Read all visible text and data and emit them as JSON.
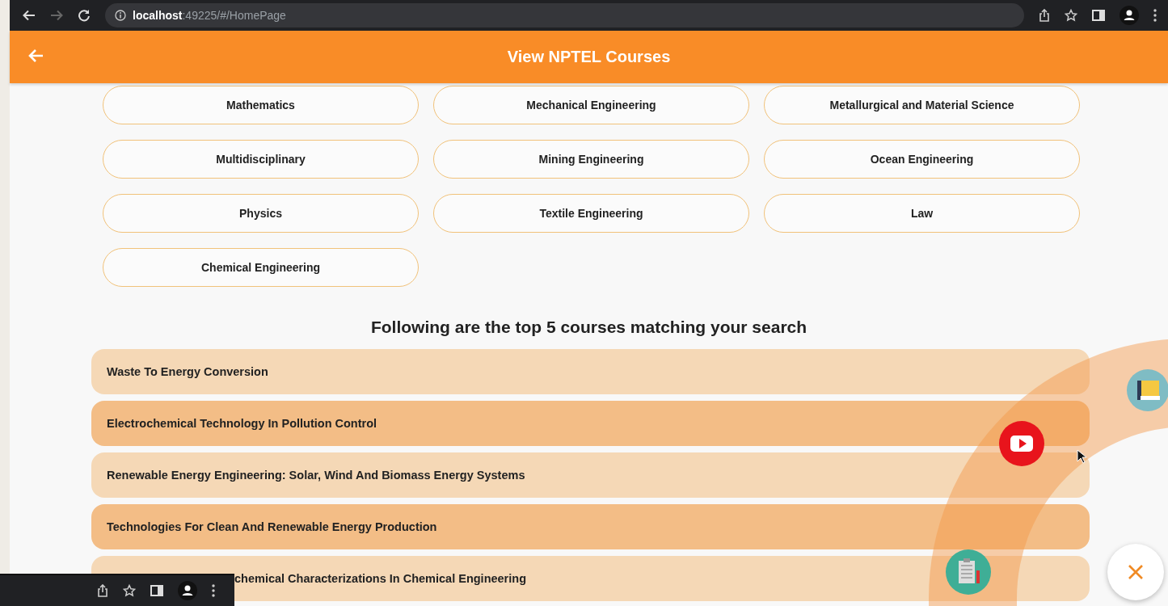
{
  "browser": {
    "url_host": "localhost",
    "url_path": ":49225/#/HomePage"
  },
  "app_bar": {
    "title": "View NPTEL Courses"
  },
  "categories": [
    "Mathematics",
    "Mechanical Engineering",
    "Metallurgical and Material Science",
    "Multidisciplinary",
    "Mining Engineering",
    "Ocean Engineering",
    "Physics",
    "Textile Engineering",
    "Law",
    "Chemical Engineering"
  ],
  "results_heading": "Following are the top 5 courses matching your search",
  "courses": [
    {
      "title": "Waste To Energy Conversion",
      "color": "#f5d8b6"
    },
    {
      "title": "Electrochemical Technology In Pollution Control",
      "color": "#f3bd86"
    },
    {
      "title": "Renewable Energy Engineering: Solar, Wind And Biomass Energy Systems",
      "color": "#f5d8b6"
    },
    {
      "title": "Technologies For Clean And Renewable Energy Production",
      "color": "#f3bd86"
    },
    {
      "title": "chemical Characterizations In Chemical Engineering",
      "color": "#f5d8b6"
    }
  ]
}
